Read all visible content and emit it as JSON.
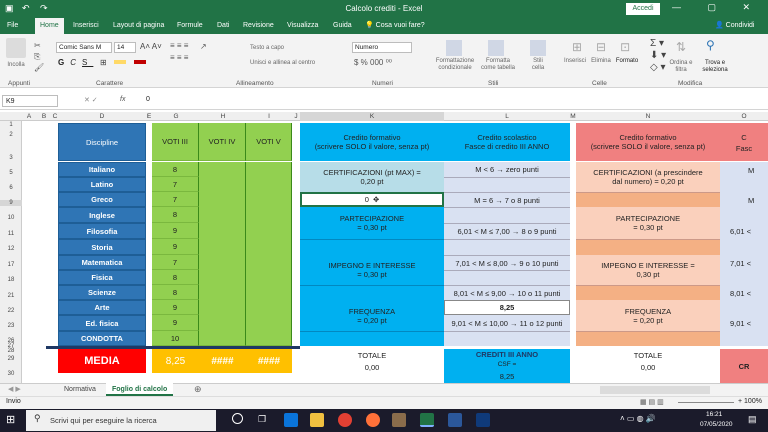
{
  "window": {
    "title": "Calcolo crediti  -  Excel",
    "signin": "Accedi",
    "controls": "— ▢ ✕"
  },
  "ribbon": {
    "tabs": [
      "File",
      "Home",
      "Inserisci",
      "Layout di pagina",
      "Formule",
      "Dati",
      "Revisione",
      "Visualizza",
      "Guida",
      "Cosa vuoi fare?"
    ],
    "share": "Condividi",
    "font_name": "Comic Sans M",
    "font_size": "14",
    "wrap_text": "Testo a capo",
    "merge": "Unisci e allinea al centro",
    "number_format": "Numero",
    "cond_format": "Formattazione condizionale",
    "table_format": "Formatta come tabella",
    "cell_styles": "Stili cella",
    "insert": "Inserisci",
    "delete": "Elimina",
    "format": "Formato",
    "sort": "Ordina e filtra",
    "find": "Trova e seleziona",
    "paste": "Incolla",
    "groups": [
      "Appunti",
      "Carattere",
      "Allineamento",
      "Numeri",
      "Stili",
      "Celle",
      "Modifica"
    ]
  },
  "formula_bar": {
    "name_box": "K9",
    "fx": "fx",
    "value": "0"
  },
  "columns": [
    "A",
    "B",
    "C",
    "D",
    "E",
    "F",
    "G",
    "H",
    "I",
    "J",
    "K",
    "L",
    "M",
    "N",
    "O"
  ],
  "rows": [
    "1",
    "2",
    "3",
    "5",
    "6",
    "9",
    "10",
    "11",
    "12",
    "17",
    "18",
    "21",
    "22",
    "23",
    "26",
    "27",
    "28",
    "29",
    "30"
  ],
  "headers": {
    "discipline": "Discipline",
    "voti3": "VOTI III",
    "voti4": "VOTI IV",
    "voti5": "VOTI V"
  },
  "subjects": [
    {
      "name": "Italiano",
      "v3": "8"
    },
    {
      "name": "Latino",
      "v3": "7"
    },
    {
      "name": "Greco",
      "v3": "7"
    },
    {
      "name": "Inglese",
      "v3": "8"
    },
    {
      "name": "Filosofia",
      "v3": "9"
    },
    {
      "name": "Storia",
      "v3": "9"
    },
    {
      "name": "Matematica",
      "v3": "7"
    },
    {
      "name": "Fisica",
      "v3": "8"
    },
    {
      "name": "Scienze",
      "v3": "8"
    },
    {
      "name": "Arte",
      "v3": "9"
    },
    {
      "name": "Ed. fisica",
      "v3": "9"
    },
    {
      "name": "CONDOTTA",
      "v3": "10"
    }
  ],
  "media": {
    "label": "MEDIA",
    "v3": "8,25",
    "v4": "####",
    "v5": "####"
  },
  "k_col": {
    "header": "Credito formativo\n(scrivere SOLO il valore, senza pt)",
    "cert": "CERTIFICAZIONI (pt MAX) =\n0,20 pt",
    "cert_val": "0",
    "part": "PARTECIPAZIONE\n= 0,30 pt",
    "impegno": "IMPEGNO E INTERESSE\n= 0,30 pt",
    "freq": "FREQUENZA\n= 0,20 pt",
    "totale": "TOTALE",
    "totale_val": "0,00"
  },
  "l_col": {
    "header": "Credito scolastico\nFasce di credito III ANNO",
    "r1": "M < 6 → zero punti",
    "r2": "M = 6 → 7 o 8 punti",
    "r3": "6,01 < M ≤ 7,00 → 8 o 9 punti",
    "r4": "7,01 < M ≤ 8,00 → 9 o 10 punti",
    "r5": "8,01 < M ≤ 9,00 → 10 o 11 punti",
    "r6": "8,25",
    "r7": "9,01 < M ≤ 10,00 → 11 o 12 punti",
    "crediti": "CREDITI III ANNO",
    "csf": "CSF =",
    "csf_val": "8,25"
  },
  "n_col": {
    "header": "Credito formativo\n(scrivere SOLO il valore, senza pt)",
    "cert": "CERTIFICAZIONI (a prescindere\ndal numero) = 0,20 pt",
    "part": "PARTECIPAZIONE\n= 0,30 pt",
    "impegno": "IMPEGNO E INTERESSE      =\n0,30 pt",
    "freq": "FREQUENZA\n= 0,20 pt",
    "totale": "TOTALE",
    "totale_val": "0,00"
  },
  "o_col": {
    "header": "C\nFasc",
    "r1": "M",
    "r2": "M",
    "r3": "6,01 <",
    "r4": "7,01 <",
    "r5": "8,01 <",
    "r7": "9,01 <",
    "cr": "CR"
  },
  "sheets": [
    "Normativa",
    "Foglio di calcolo"
  ],
  "status": {
    "mode": "Invio",
    "zoom": "+ 100%"
  },
  "taskbar": {
    "search": "Scrivi qui per eseguire la ricerca",
    "time": "16:21",
    "date": "07/05/2020"
  },
  "colors": {
    "excel_green": "#217346",
    "subject_blue": "#2f75b5",
    "grade_green": "#92d050",
    "cyan": "#00b0f0",
    "media_red": "#ff0000",
    "media_orange": "#ffc000",
    "salmon": "#f4b084"
  }
}
